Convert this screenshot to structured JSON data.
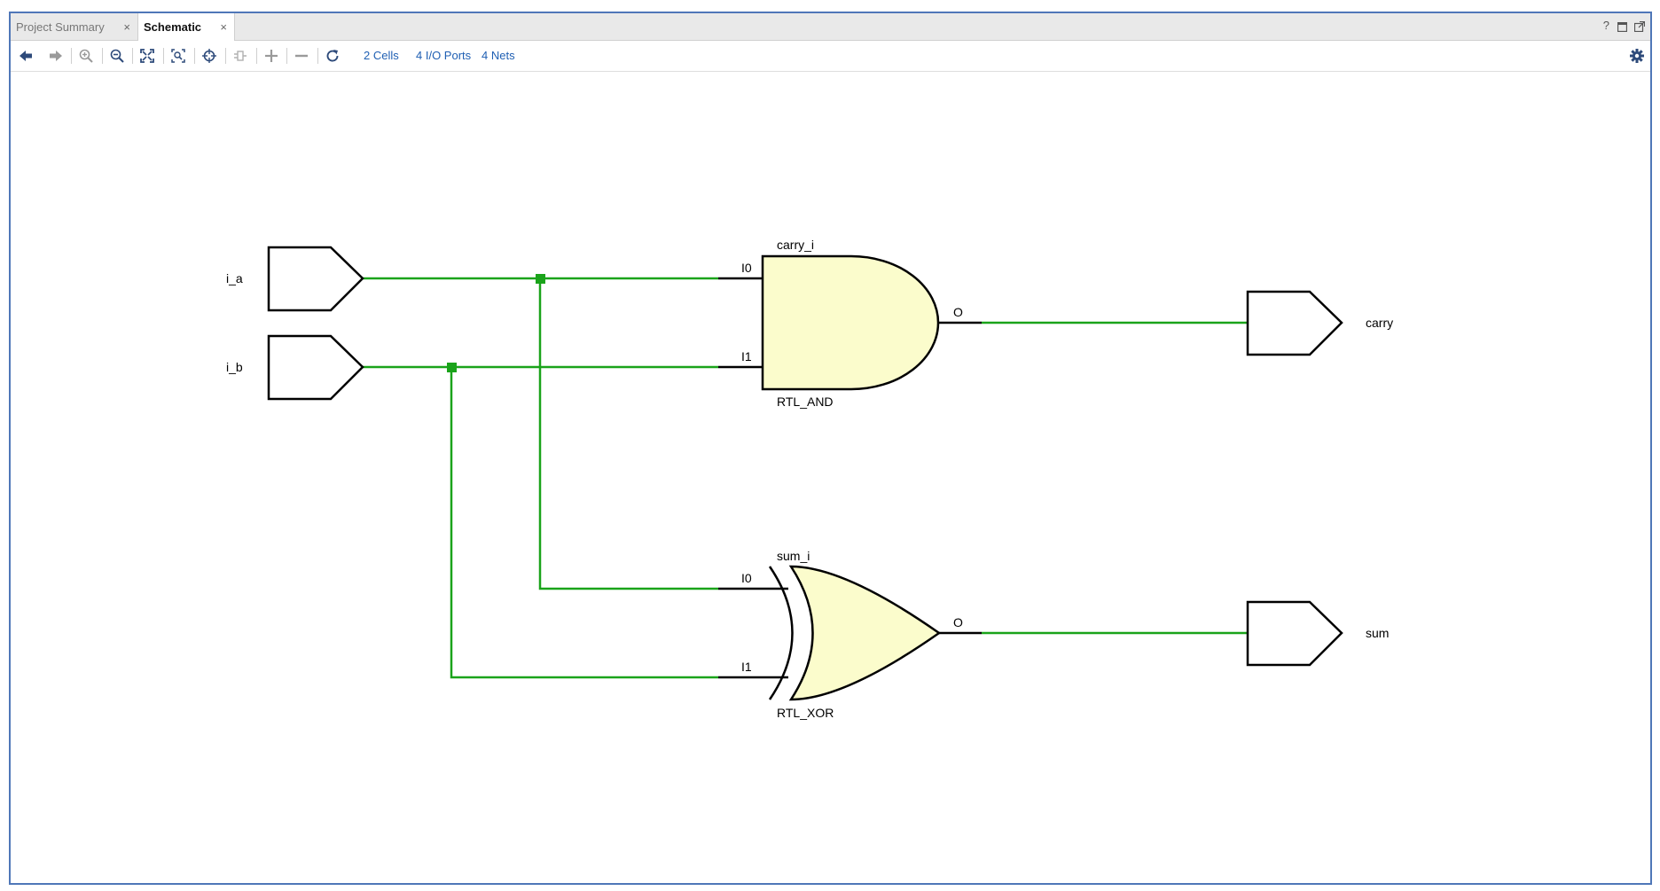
{
  "tabs": [
    {
      "label": "Project Summary",
      "active": false
    },
    {
      "label": "Schematic",
      "active": true
    }
  ],
  "tab_close_glyph": "×",
  "window_controls": {
    "help": "?"
  },
  "toolbar": {
    "buttons": [
      "back-icon",
      "forward-icon",
      "zoom-in-icon",
      "zoom-out-icon",
      "zoom-fit-icon",
      "zoom-area-icon",
      "select-icon",
      "route-icon",
      "add-icon",
      "remove-icon",
      "refresh-icon"
    ],
    "cells_link": "2 Cells",
    "ports_link": "4 I/O Ports",
    "nets_link": "4 Nets",
    "settings": "gear-icon"
  },
  "schematic": {
    "colors": {
      "wire": "#1aa31a",
      "gate_fill": "#fbfccc",
      "stroke": "#000000"
    },
    "ports": {
      "inputs": [
        "i_a",
        "i_b"
      ],
      "outputs": [
        "carry",
        "sum"
      ]
    },
    "cells": [
      {
        "instance": "carry_i",
        "type": "RTL_AND",
        "pin_in0": "I0",
        "pin_in1": "I1",
        "pin_out": "O"
      },
      {
        "instance": "sum_i",
        "type": "RTL_XOR",
        "pin_in0": "I0",
        "pin_in1": "I1",
        "pin_out": "O"
      }
    ]
  }
}
